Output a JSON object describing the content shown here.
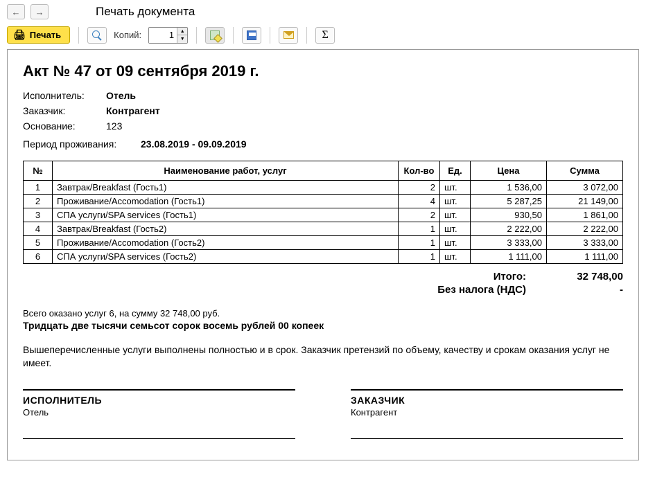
{
  "window": {
    "title": "Печать документа"
  },
  "toolbar": {
    "print_label": "Печать",
    "copies_label": "Копий:",
    "copies_value": "1"
  },
  "doc": {
    "heading": "Акт № 47 от 09 сентября 2019 г.",
    "meta": {
      "performer_label": "Исполнитель:",
      "performer": "Отель",
      "customer_label": "Заказчик:",
      "customer": "Контрагент",
      "basis_label": "Основание:",
      "basis": "123",
      "period_label": "Период проживания:",
      "period": "23.08.2019 - 09.09.2019"
    },
    "columns": {
      "num": "№",
      "name": "Наименование работ, услуг",
      "qty": "Кол-во",
      "unit": "Ед.",
      "price": "Цена",
      "sum": "Сумма"
    },
    "rows": [
      {
        "num": "1",
        "name": "Завтрак/Breakfast (Гость1)",
        "qty": "2",
        "unit": "шт.",
        "price": "1 536,00",
        "sum": "3 072,00"
      },
      {
        "num": "2",
        "name": "Проживание/Accomodation (Гость1)",
        "qty": "4",
        "unit": "шт.",
        "price": "5 287,25",
        "sum": "21 149,00"
      },
      {
        "num": "3",
        "name": "СПА услуги/SPA services (Гость1)",
        "qty": "2",
        "unit": "шт.",
        "price": "930,50",
        "sum": "1 861,00"
      },
      {
        "num": "4",
        "name": "Завтрак/Breakfast (Гость2)",
        "qty": "1",
        "unit": "шт.",
        "price": "2 222,00",
        "sum": "2 222,00"
      },
      {
        "num": "5",
        "name": "Проживание/Accomodation (Гость2)",
        "qty": "1",
        "unit": "шт.",
        "price": "3 333,00",
        "sum": "3 333,00"
      },
      {
        "num": "6",
        "name": "СПА услуги/SPA services (Гость2)",
        "qty": "1",
        "unit": "шт.",
        "price": "1 111,00",
        "sum": "1 111,00"
      }
    ],
    "totals": {
      "total_label": "Итого:",
      "total_value": "32 748,00",
      "tax_label": "Без налога (НДС)",
      "tax_value": "-"
    },
    "summary_line": "Всего оказано услуг 6, на сумму 32 748,00 руб.",
    "amount_words": "Тридцать две тысячи семьсот сорок восемь рублей 00 копеек",
    "note": "Вышеперечисленные услуги выполнены полностью и в срок. Заказчик претензий по объему, качеству и срокам оказания услуг не имеет.",
    "sign": {
      "performer_title": "ИСПОЛНИТЕЛЬ",
      "performer_name": "Отель",
      "customer_title": "ЗАКАЗЧИК",
      "customer_name": "Контрагент"
    }
  }
}
